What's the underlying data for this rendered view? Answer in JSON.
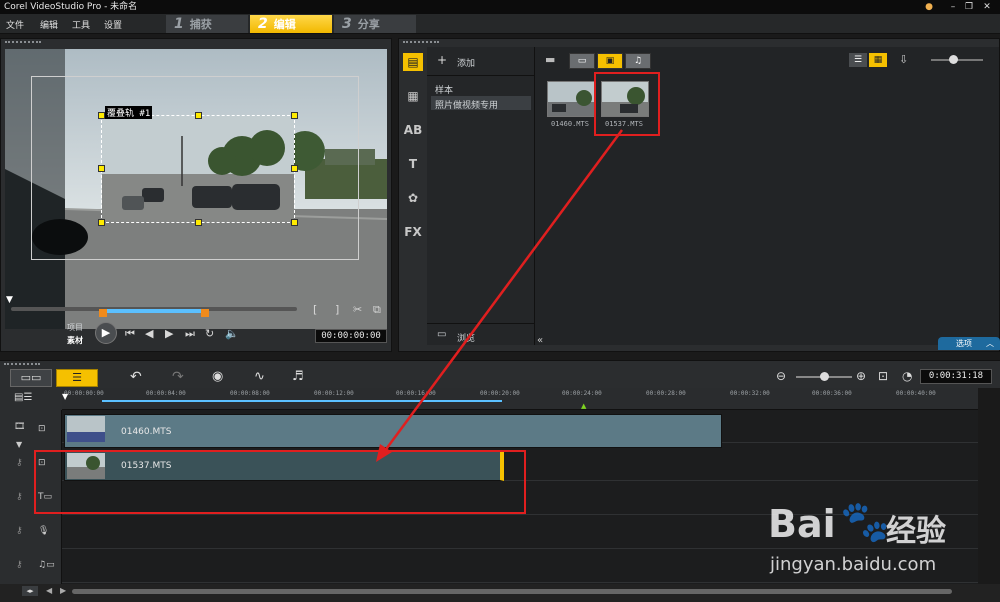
{
  "window": {
    "title": "Corel VideoStudio Pro - 未命名",
    "controls": [
      "minimize-icon",
      "restore-icon",
      "close-icon"
    ]
  },
  "menu": {
    "items": [
      "文件",
      "编辑",
      "工具",
      "设置"
    ],
    "steps": [
      {
        "num": "1",
        "label": "捕获"
      },
      {
        "num": "2",
        "label": "编辑"
      },
      {
        "num": "3",
        "label": "分享"
      }
    ],
    "active_step": "编辑"
  },
  "preview": {
    "overlay_label": "覆叠轨 #1",
    "mode_project": "项目",
    "mode_clip": "素材",
    "timecode": "00:00:00:00",
    "trim_in": "[",
    "trim_out": "]"
  },
  "library": {
    "add_label": "添加",
    "folders": [
      "样本",
      "照片做视频专用"
    ],
    "selected_folder": "照片做视频专用",
    "browse_label": "浏览",
    "options_label": "选项",
    "media": [
      {
        "name": "01460.MTS"
      },
      {
        "name": "01537.MTS"
      }
    ]
  },
  "timeline": {
    "duration": "0:00:31:18",
    "ruler_ticks": [
      "00:00:00:00",
      "00:00:04:00",
      "00:00:08:00",
      "00:00:12:00",
      "00:00:16:00",
      "00:00:20:00",
      "00:00:24:00",
      "00:00:28:00",
      "00:00:32:00",
      "00:00:36:00",
      "00:00:40:00"
    ],
    "clips": [
      {
        "name": "01460.MTS",
        "track": "video"
      },
      {
        "name": "01537.MTS",
        "track": "overlay"
      }
    ]
  },
  "watermark": {
    "brand_a": "Bai",
    "brand_b": "经验",
    "url": "jingyan.baidu.com"
  },
  "colors": {
    "accent": "#f5c000",
    "highlight": "#e01f1f",
    "clip_video": "#5c7a86",
    "clip_overlay": "#3a5258"
  }
}
